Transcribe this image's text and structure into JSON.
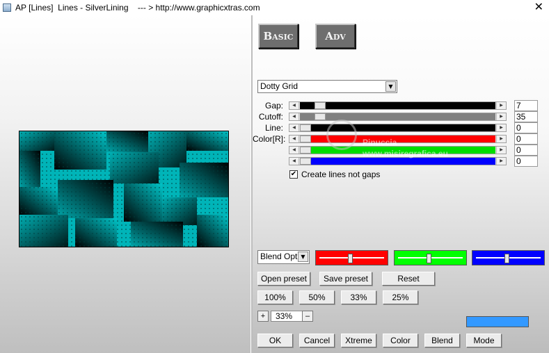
{
  "window": {
    "title": "AP [Lines]  Lines - SilverLining    --- > http://www.graphicxtras.com",
    "close_glyph": "✕"
  },
  "tabs": {
    "basic_label": "Basic",
    "adv_label": "Adv"
  },
  "preset_select": {
    "value": "Dotty Grid"
  },
  "sliders": [
    {
      "label": "Gap:",
      "value": "7",
      "fraction": 0.08,
      "track_color": "#000000"
    },
    {
      "label": "Cutoff:",
      "value": "35",
      "fraction": 0.08,
      "track_color": "#808080"
    },
    {
      "label": "Line:",
      "value": "0",
      "fraction": 0.0,
      "track_color": "#000000"
    },
    {
      "label": "Color[R]:",
      "value": "0",
      "fraction": 0.0,
      "track_color": "#ff0000"
    },
    {
      "label": "",
      "value": "0",
      "fraction": 0.0,
      "track_color": "#00dd00"
    },
    {
      "label": "",
      "value": "0",
      "fraction": 0.0,
      "track_color": "#0000ff"
    }
  ],
  "checkbox": {
    "label": "Create lines not gaps",
    "checked_glyph": "✔"
  },
  "blend_select": {
    "value": "Blend Optio"
  },
  "color_sliders": [
    {
      "color": "#ff0000",
      "fraction": 0.47
    },
    {
      "color": "#00ff00",
      "fraction": 0.47
    },
    {
      "color": "#0000ff",
      "fraction": 0.47
    }
  ],
  "buttons": {
    "open_preset": "Open preset",
    "save_preset": "Save preset",
    "reset": "Reset",
    "zoom_100": "100%",
    "zoom_50": "50%",
    "zoom_33": "33%",
    "zoom_25": "25%",
    "ok": "OK",
    "cancel": "Cancel",
    "xtreme": "Xtreme",
    "color": "Color",
    "blend": "Blend",
    "mode": "Mode"
  },
  "zoom": {
    "plus": "+",
    "minus": "–",
    "value": "33%"
  },
  "swatch_color": "#3399ff",
  "watermark": {
    "name": "Pinuccia",
    "url": "www.misiregrafica.eu"
  }
}
